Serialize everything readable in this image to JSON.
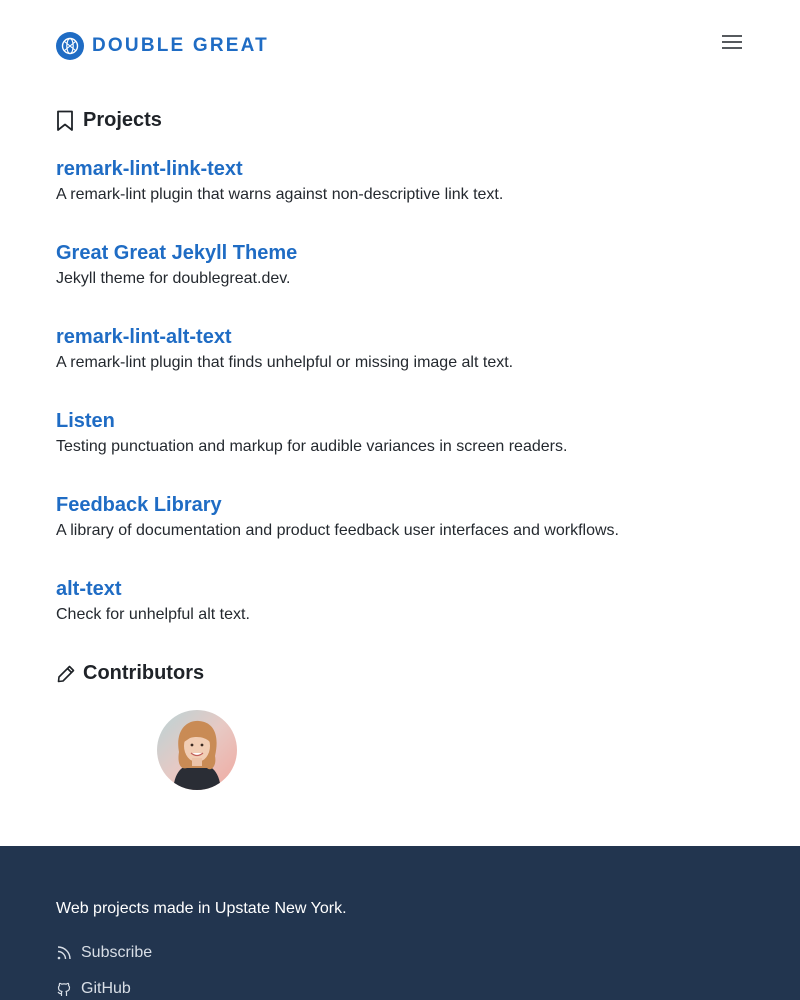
{
  "header": {
    "brand_name": "DOUBLE GREAT",
    "logo_icon": "globe-logo-icon",
    "menu_icon": "hamburger-menu-icon"
  },
  "projects_section": {
    "heading": "Projects",
    "icon": "bookmark-icon",
    "items": [
      {
        "title": "remark-lint-link-text",
        "description": "A remark-lint plugin that warns against non-descriptive link text."
      },
      {
        "title": "Great Great Jekyll Theme",
        "description": "Jekyll theme for doublegreat.dev."
      },
      {
        "title": "remark-lint-alt-text",
        "description": "A remark-lint plugin that finds unhelpful or missing image alt text."
      },
      {
        "title": "Listen",
        "description": "Testing punctuation and markup for audible variances in screen readers."
      },
      {
        "title": "Feedback Library",
        "description": "A library of documentation and product feedback user interfaces and workflows."
      },
      {
        "title": "alt-text",
        "description": "Check for unhelpful alt text."
      }
    ]
  },
  "contributors_section": {
    "heading": "Contributors",
    "icon": "pencil-icon",
    "avatars": [
      "contributor-avatar"
    ]
  },
  "footer": {
    "tagline": "Web projects made in Upstate New York.",
    "links": [
      {
        "label": "Subscribe",
        "icon": "rss-icon"
      },
      {
        "label": "GitHub",
        "icon": "github-icon"
      }
    ]
  },
  "colors": {
    "accent": "#1f6cc4",
    "footer_bg": "#22354f",
    "text": "#1f2328"
  }
}
